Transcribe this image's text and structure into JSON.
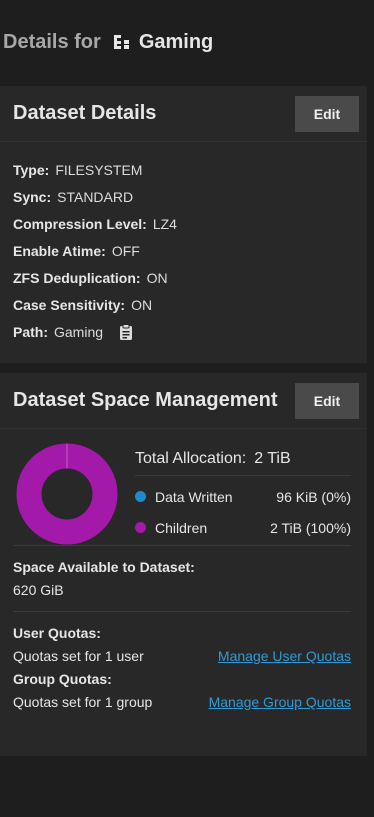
{
  "header": {
    "lead": "Details for",
    "dataset_name": "Gaming"
  },
  "details_card": {
    "title": "Dataset Details",
    "edit_label": "Edit",
    "rows": [
      {
        "label": "Type:",
        "value": "FILESYSTEM"
      },
      {
        "label": "Sync:",
        "value": "STANDARD"
      },
      {
        "label": "Compression Level:",
        "value": "LZ4"
      },
      {
        "label": "Enable Atime:",
        "value": "OFF"
      },
      {
        "label": "ZFS Deduplication:",
        "value": "ON"
      },
      {
        "label": "Case Sensitivity:",
        "value": "ON"
      },
      {
        "label": "Path:",
        "value": "Gaming"
      }
    ]
  },
  "space_card": {
    "title": "Dataset Space Management",
    "edit_label": "Edit",
    "total_label": "Total Allocation:",
    "total_value": "2 TiB",
    "legend": [
      {
        "name": "Data Written",
        "value": "96 KiB (0%)",
        "color": "#1a8ccb",
        "fraction": 0.0
      },
      {
        "name": "Children",
        "value": "2 TiB (100%)",
        "color": "#a31aaa",
        "fraction": 1.0
      }
    ],
    "available_label": "Space Available to Dataset:",
    "available_value": "620 GiB",
    "user_quotas_label": "User Quotas:",
    "user_quotas_text": "Quotas set for 1 user",
    "user_quotas_link": "Manage User Quotas",
    "group_quotas_label": "Group Quotas:",
    "group_quotas_text": "Quotas set for 1 group",
    "group_quotas_link": "Manage Group Quotas"
  },
  "icons": {
    "dataset": "dataset-tree-icon",
    "copy": "clipboard-icon"
  }
}
